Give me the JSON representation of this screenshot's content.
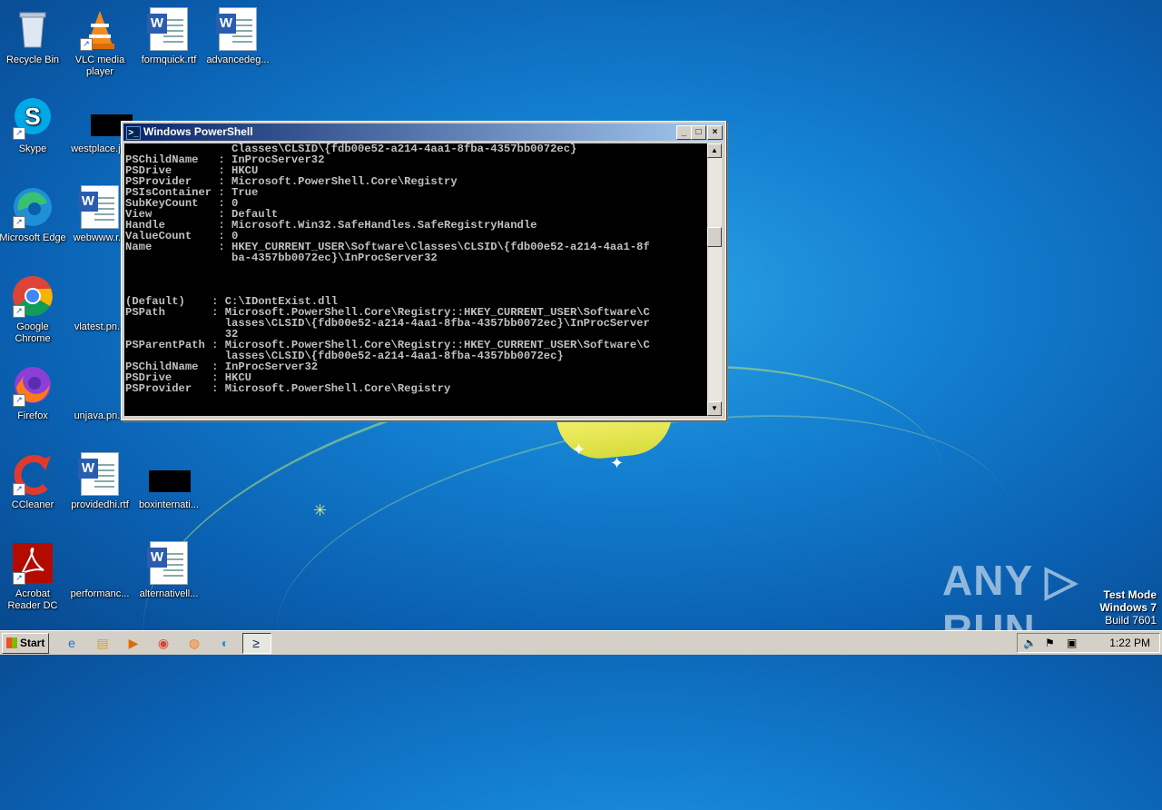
{
  "desktop": {
    "icons": [
      {
        "label": "Recycle Bin",
        "icon": "recycle-bin-icon"
      },
      {
        "label": "VLC media player",
        "icon": "vlc-icon"
      },
      {
        "label": "formquick.rtf",
        "icon": "word-doc-icon"
      },
      {
        "label": "advancedeg...",
        "icon": "word-doc-icon"
      },
      {
        "label": "Skype",
        "icon": "skype-icon"
      },
      {
        "label": "westplace.j...",
        "icon": "image-icon"
      },
      {
        "label": "Microsoft Edge",
        "icon": "edge-icon"
      },
      {
        "label": "webwww.r...",
        "icon": "word-doc-icon"
      },
      {
        "label": "Google Chrome",
        "icon": "chrome-icon"
      },
      {
        "label": "vlatest.pn...",
        "icon": "image-icon"
      },
      {
        "label": "Firefox",
        "icon": "firefox-icon"
      },
      {
        "label": "unjava.pn...",
        "icon": "image-icon"
      },
      {
        "label": "CCleaner",
        "icon": "ccleaner-icon"
      },
      {
        "label": "providedhi.rtf",
        "icon": "word-doc-icon"
      },
      {
        "label": "boxinternati...",
        "icon": "image-icon"
      },
      {
        "label": "Acrobat Reader DC",
        "icon": "acrobat-icon"
      },
      {
        "label": "performanc...",
        "icon": "image-icon"
      },
      {
        "label": "alternativell...",
        "icon": "word-doc-icon"
      }
    ]
  },
  "window": {
    "title": "Windows PowerShell",
    "controls": {
      "minimize": "_",
      "maximize": "□",
      "close": "×"
    },
    "console_text": "                Classes\\CLSID\\{fdb00e52-a214-4aa1-8fba-4357bb0072ec}\nPSChildName   : InProcServer32\nPSDrive       : HKCU\nPSProvider    : Microsoft.PowerShell.Core\\Registry\nPSIsContainer : True\nSubKeyCount   : 0\nView          : Default\nHandle        : Microsoft.Win32.SafeHandles.SafeRegistryHandle\nValueCount    : 0\nName          : HKEY_CURRENT_USER\\Software\\Classes\\CLSID\\{fdb00e52-a214-4aa1-8f\n                ba-4357bb0072ec}\\InProcServer32\n\n\n\n(Default)    : C:\\IDontExist.dll\nPSPath       : Microsoft.PowerShell.Core\\Registry::HKEY_CURRENT_USER\\Software\\C\n               lasses\\CLSID\\{fdb00e52-a214-4aa1-8fba-4357bb0072ec}\\InProcServer\n               32\nPSParentPath : Microsoft.PowerShell.Core\\Registry::HKEY_CURRENT_USER\\Software\\C\n               lasses\\CLSID\\{fdb00e52-a214-4aa1-8fba-4357bb0072ec}\nPSChildName  : InProcServer32\nPSDrive      : HKCU\nPSProvider   : Microsoft.PowerShell.Core\\Registry\n\n\nAMSI do"
  },
  "watermark": {
    "brand": "ANY ▷ RUN"
  },
  "test_mode": {
    "line1": "Test Mode",
    "line2": "Windows 7",
    "line3": "Build 7601"
  },
  "taskbar": {
    "start_label": "Start",
    "pinned": [
      "ie-icon",
      "explorer-icon",
      "media-player-icon",
      "chrome-icon",
      "firefox-icon",
      "edge-icon",
      "powershell-icon"
    ],
    "clock": "1:22 PM"
  },
  "colors": {
    "console_bg": "#000000",
    "console_fg": "#c0c0c0",
    "title_bar": "#0a246a"
  }
}
